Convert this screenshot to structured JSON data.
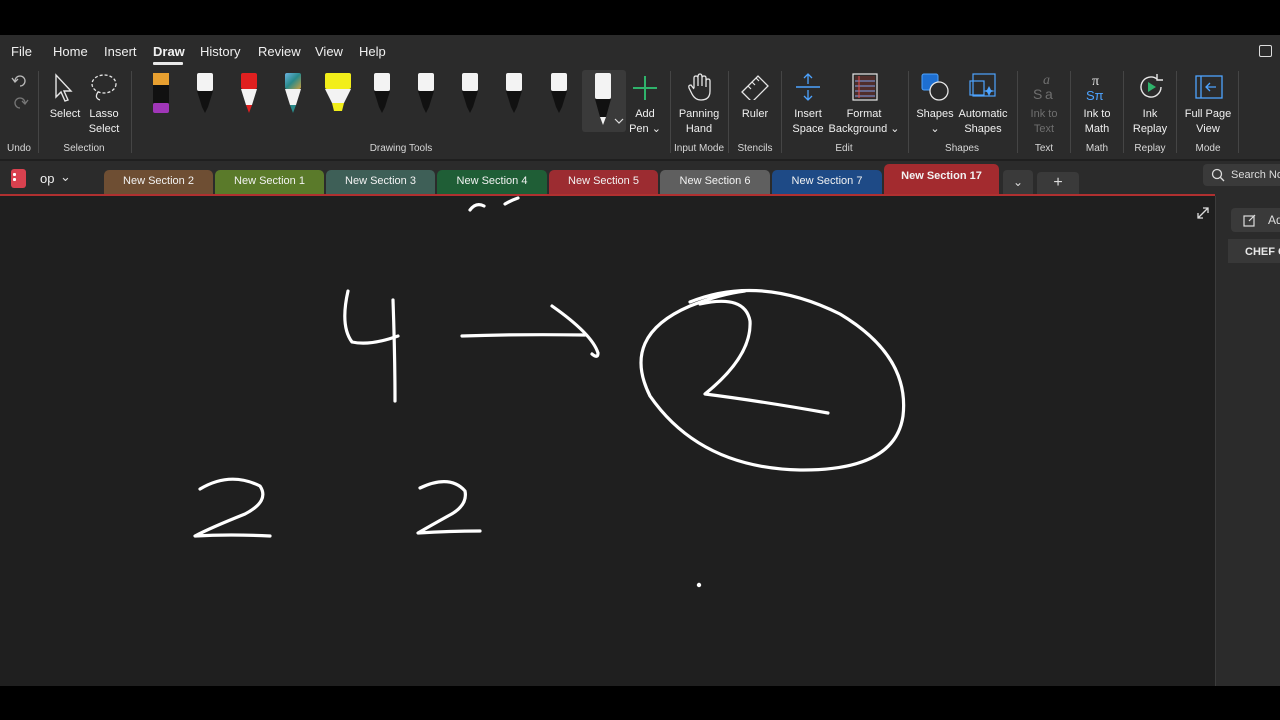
{
  "menu": {
    "items": [
      "File",
      "Home",
      "Insert",
      "Draw",
      "History",
      "Review",
      "View",
      "Help"
    ],
    "active": "Draw"
  },
  "ribbon": {
    "undo_group": "Undo",
    "selection": {
      "select": "Select",
      "lasso_line1": "Lasso",
      "lasso_line2": "Select",
      "group": "Selection"
    },
    "drawing_tools": {
      "group": "Drawing Tools",
      "pens": [
        {
          "name": "pen-orange-black-purple",
          "color": "#e8a030"
        },
        {
          "name": "pen-black",
          "color": "#111111"
        },
        {
          "name": "pen-red",
          "color": "#e02020"
        },
        {
          "name": "pen-galaxy",
          "color": "#2a8a8a"
        },
        {
          "name": "highlighter-yellow",
          "color": "#f2ee1a"
        },
        {
          "name": "pen-black-2",
          "color": "#111111"
        },
        {
          "name": "pen-black-3",
          "color": "#111111"
        },
        {
          "name": "pen-black-4",
          "color": "#111111"
        },
        {
          "name": "pen-black-5",
          "color": "#111111"
        },
        {
          "name": "pen-black-6",
          "color": "#111111"
        },
        {
          "name": "pen-white-selected",
          "color": "#f5f5f5"
        }
      ],
      "add_pen_line1": "Add",
      "add_pen_line2": "Pen"
    },
    "input_mode": {
      "line1": "Panning",
      "line2": "Hand",
      "group": "Input Mode"
    },
    "stencils": {
      "ruler": "Ruler",
      "group": "Stencils"
    },
    "edit": {
      "insert_line1": "Insert",
      "insert_line2": "Space",
      "format_line1": "Format",
      "format_line2": "Background",
      "group": "Edit"
    },
    "shapes": {
      "shapes": "Shapes",
      "auto_line1": "Automatic",
      "auto_line2": "Shapes",
      "group": "Shapes"
    },
    "text": {
      "line1": "Ink to",
      "line2": "Text",
      "group": "Text"
    },
    "math": {
      "line1": "Ink to",
      "line2": "Math",
      "group": "Math"
    },
    "replay": {
      "line1": "Ink",
      "line2": "Replay",
      "group": "Replay"
    },
    "mode": {
      "line1": "Full Page",
      "line2": "View",
      "group": "Mode"
    }
  },
  "notebook": {
    "name": "op"
  },
  "sections": [
    {
      "label": "New Section 2",
      "color": "#6e4e33"
    },
    {
      "label": "New Section 1",
      "color": "#5a7a2a"
    },
    {
      "label": "New Section 3",
      "color": "#3e5f57"
    },
    {
      "label": "New Section 4",
      "color": "#1f5e36"
    },
    {
      "label": "New Section 5",
      "color": "#9c2c31"
    },
    {
      "label": "New Section 6",
      "color": "#5f5f5f"
    },
    {
      "label": "New Section 7",
      "color": "#1e4a86"
    },
    {
      "label": "New Section 17",
      "color": "#a32b2f",
      "active": true
    }
  ],
  "search": {
    "placeholder": "Search Not"
  },
  "pages_pane": {
    "add_page": "Add",
    "page_title": "CHEF C"
  },
  "canvas": {
    "background": "#1f1f1f",
    "ink_color": "#ffffff"
  }
}
